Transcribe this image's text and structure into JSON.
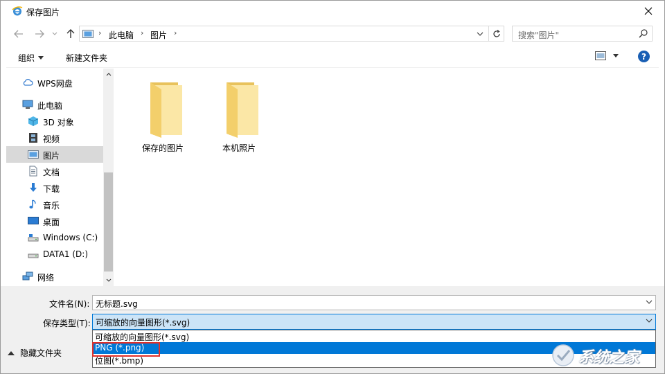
{
  "window": {
    "title": "保存图片"
  },
  "navigation": {
    "address": {
      "segments": [
        "此电脑",
        "图片"
      ]
    },
    "search": {
      "placeholder": "搜索\"图片\""
    }
  },
  "toolbar": {
    "organize_label": "组织",
    "new_folder_label": "新建文件夹"
  },
  "sidebar": {
    "items": [
      {
        "label": "WPS网盘",
        "icon": "cloud-icon"
      },
      {
        "label": "此电脑",
        "icon": "computer-icon"
      },
      {
        "label": "3D 对象",
        "icon": "cube-icon"
      },
      {
        "label": "视频",
        "icon": "film-icon"
      },
      {
        "label": "图片",
        "icon": "picture-icon",
        "selected": true
      },
      {
        "label": "文档",
        "icon": "document-icon"
      },
      {
        "label": "下载",
        "icon": "download-arrow-icon"
      },
      {
        "label": "音乐",
        "icon": "music-note-icon"
      },
      {
        "label": "桌面",
        "icon": "desktop-icon"
      },
      {
        "label": "Windows (C:)",
        "icon": "drive-icon"
      },
      {
        "label": "DATA1 (D:)",
        "icon": "drive-icon"
      },
      {
        "label": "网络",
        "icon": "network-icon"
      }
    ]
  },
  "main": {
    "folders": [
      {
        "name": "保存的图片"
      },
      {
        "name": "本机照片"
      }
    ]
  },
  "form": {
    "filename_label": "文件名(N):",
    "filename_value": "无标题.svg",
    "filetype_label": "保存类型(T):",
    "filetype_value": "可缩放的向量图形(*.svg)",
    "filetype_options": [
      {
        "label": "可缩放的向量图形(*.svg)"
      },
      {
        "label": "PNG (*.png)",
        "selected": true
      },
      {
        "label": "位图(*.bmp)"
      }
    ]
  },
  "footer": {
    "hide_folders_label": "隐藏文件夹"
  },
  "watermark": {
    "text": "系统之家"
  },
  "colors": {
    "accent": "#0078d7",
    "selection_gray": "#d9d9d9",
    "folder_yellow": "#f8d775",
    "highlight_red": "#e0302a"
  }
}
